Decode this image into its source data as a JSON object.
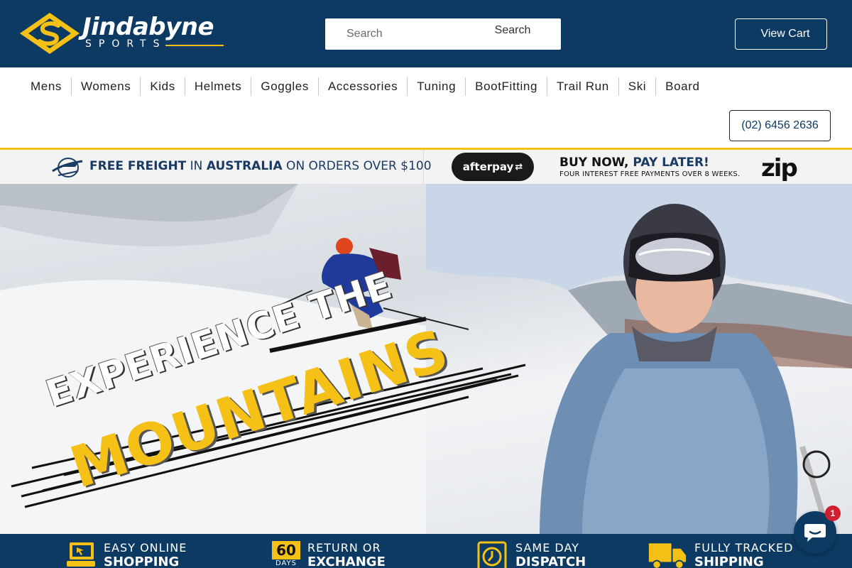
{
  "header": {
    "brand_name": "Jindabyne",
    "brand_sub": "SPORTS",
    "search": {
      "placeholder": "Search",
      "button_label": "Search"
    },
    "cart_label": "View Cart"
  },
  "nav": {
    "items": [
      "Mens",
      "Womens",
      "Kids",
      "Helmets",
      "Goggles",
      "Accessories",
      "Tuning",
      "BootFitting",
      "Trail Run",
      "Ski",
      "Board"
    ],
    "phone": "(02) 6456 2636"
  },
  "promo": {
    "freight_1": "FREE FREIGHT",
    "freight_2": " IN ",
    "freight_3": "AUSTRALIA",
    "freight_4": " ON ORDERS OVER $100",
    "afterpay": "afterpay",
    "bnpl_1": "BUY NOW, ",
    "bnpl_2": "PAY LATER!",
    "bnpl_sub": "FOUR INTEREST FREE PAYMENTS OVER 8 WEEKS.",
    "zip": "zip"
  },
  "hero": {
    "line1": "EXPERIENCE THE",
    "line2": "MOUNTAINS"
  },
  "features": [
    {
      "top": "EASY ONLINE",
      "bottom": "SHOPPING"
    },
    {
      "top": "RETURN OR",
      "bottom": "EXCHANGE",
      "badge": "60",
      "badge_sub": "DAYS"
    },
    {
      "top": "SAME DAY",
      "bottom": "DISPATCH"
    },
    {
      "top": "FULLY TRACKED",
      "bottom": "SHIPPING"
    }
  ],
  "chat": {
    "badge_count": "1"
  },
  "colors": {
    "navy": "#0d3a62",
    "yellow": "#f5c116"
  }
}
